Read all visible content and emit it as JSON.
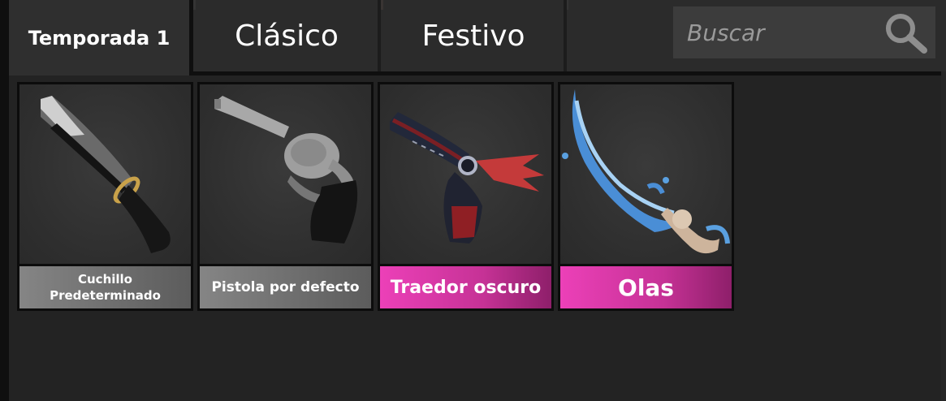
{
  "tabs": [
    {
      "label": "Temporada 1",
      "selected": true
    },
    {
      "label": "Clásico",
      "selected": false
    },
    {
      "label": "Festivo",
      "selected": false
    }
  ],
  "search": {
    "placeholder": "Buscar",
    "icon": "search-icon"
  },
  "items": [
    {
      "name": "Cuchillo Predeterminado",
      "rarity": "common",
      "icon": "knife-icon"
    },
    {
      "name": "Pistola por defecto",
      "rarity": "common",
      "icon": "revolver-icon"
    },
    {
      "name": "Traedor oscuro",
      "rarity": "godly",
      "icon": "dark-gun-icon"
    },
    {
      "name": "Olas",
      "rarity": "godly",
      "icon": "wave-blade-icon"
    }
  ],
  "colors": {
    "background": "#232323",
    "godly": "#ec40b8",
    "common": "#858585",
    "panel": "#2b2b2b"
  }
}
